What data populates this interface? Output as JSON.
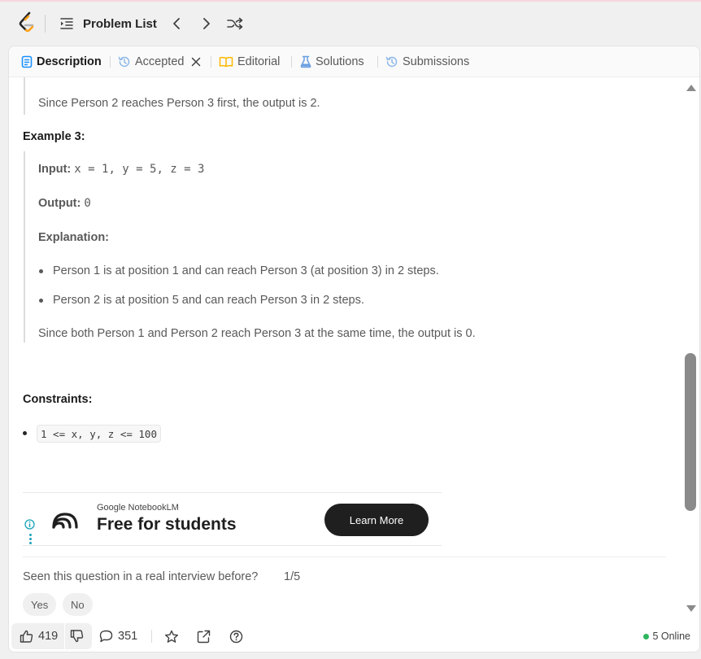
{
  "nav": {
    "problem_list_label": "Problem List"
  },
  "tabs": [
    {
      "label": "Description",
      "icon": "description-icon"
    },
    {
      "label": "Accepted",
      "icon": "history-icon"
    },
    {
      "label": "Editorial",
      "icon": "book-icon"
    },
    {
      "label": "Solutions",
      "icon": "flask-icon"
    },
    {
      "label": "Submissions",
      "icon": "history-icon"
    }
  ],
  "content": {
    "example2_tail": "Since Person 2 reaches Person 3 first, the output is 2.",
    "example3_title": "Example 3:",
    "input_label": "Input:",
    "input_value": "x = 1, y = 5, z = 3",
    "output_label": "Output:",
    "output_value": "0",
    "explanation_label": "Explanation:",
    "explanation_items": [
      "Person 1 is at position 1 and can reach Person 3 (at position 3) in 2 steps.",
      "Person 2 is at position 5 and can reach Person 3 in 2 steps."
    ],
    "explanation_conclusion": "Since both Person 1 and Person 2 reach Person 3 at the same time, the output is 0.",
    "constraints_title": "Constraints:",
    "constraints": [
      "1 <= x, y, z <= 100"
    ]
  },
  "ad": {
    "brand": "Google NotebookLM",
    "headline": "Free for students",
    "cta": "Learn More"
  },
  "feedback": {
    "question": "Seen this question in a real interview before?",
    "count": "1/5",
    "yes": "Yes",
    "no": "No"
  },
  "bottom": {
    "likes": "419",
    "comments": "351",
    "online": "5 Online"
  },
  "colors": {
    "accent_orange": "#FFA116",
    "tab_blue": "#1a90ff",
    "editorial_orange": "#ffb800",
    "online_green": "#2db55d"
  }
}
